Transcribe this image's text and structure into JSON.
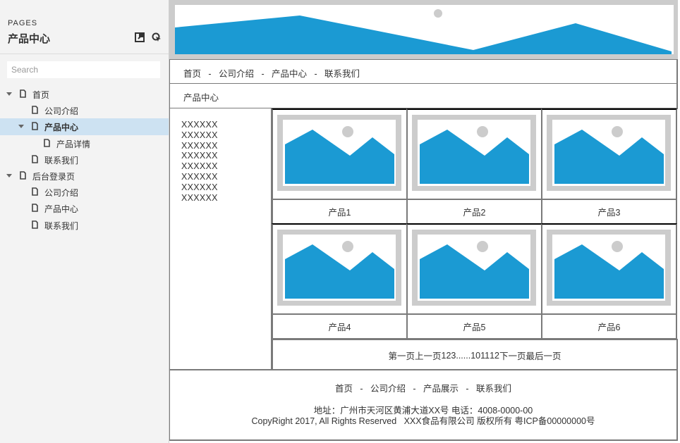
{
  "sidebar": {
    "section_label": "PAGES",
    "title": "产品中心",
    "icons": [
      "export-icon",
      "preview-icon"
    ],
    "search": {
      "placeholder": "Search",
      "value": ""
    },
    "tree": [
      {
        "label": "首页",
        "level": 0,
        "expanded": true,
        "selected": false
      },
      {
        "label": "公司介绍",
        "level": 1,
        "expanded": null,
        "selected": false
      },
      {
        "label": "产品中心",
        "level": 1,
        "expanded": true,
        "selected": true
      },
      {
        "label": "产品详情",
        "level": 2,
        "expanded": null,
        "selected": false
      },
      {
        "label": "联系我们",
        "level": 1,
        "expanded": null,
        "selected": false
      },
      {
        "label": "后台登录页",
        "level": 0,
        "expanded": true,
        "selected": false
      },
      {
        "label": "公司介绍",
        "level": 1,
        "expanded": null,
        "selected": false
      },
      {
        "label": "产品中心",
        "level": 1,
        "expanded": null,
        "selected": false
      },
      {
        "label": "联系我们",
        "level": 1,
        "expanded": null,
        "selected": false
      }
    ]
  },
  "page": {
    "banner": {
      "type": "image-placeholder"
    },
    "nav": {
      "items": [
        "首页",
        "公司介绍",
        "产品中心",
        "联系我们"
      ],
      "separator": "-"
    },
    "breadcrumb": "产品中心",
    "side_text": [
      "XXXXXX",
      "XXXXXX",
      "XXXXXX",
      "XXXXXX",
      "XXXXXX",
      "XXXXXX",
      "XXXXXX",
      "XXXXXX"
    ],
    "products": [
      {
        "name": "产品1"
      },
      {
        "name": "产品2"
      },
      {
        "name": "产品3"
      },
      {
        "name": "产品4"
      },
      {
        "name": "产品5"
      },
      {
        "name": "产品6"
      }
    ],
    "pagination": {
      "first": "第一页",
      "prev": "上一页",
      "pages": [
        "1",
        "2",
        "3"
      ],
      "ellipsis": "......",
      "pages_end": [
        "10",
        "11",
        "12"
      ],
      "next": "下一页",
      "last": "最后一页"
    },
    "footer": {
      "nav_items": [
        "首页",
        "公司介绍",
        "产品展示",
        "联系我们"
      ],
      "separator": "-",
      "address": "地址：广州市天河区黄浦大道XX号  电话：4008-0000-00",
      "copyright": "CopyRight 2017, All Rights Reserved   XXX食品有限公司 版权所有 粤ICP备00000000号"
    }
  },
  "colors": {
    "accent_blue": "#1b9ad3",
    "placeholder_gray": "#cccccc",
    "selected_row": "#cde2f2",
    "border": "#7a7a7a"
  }
}
